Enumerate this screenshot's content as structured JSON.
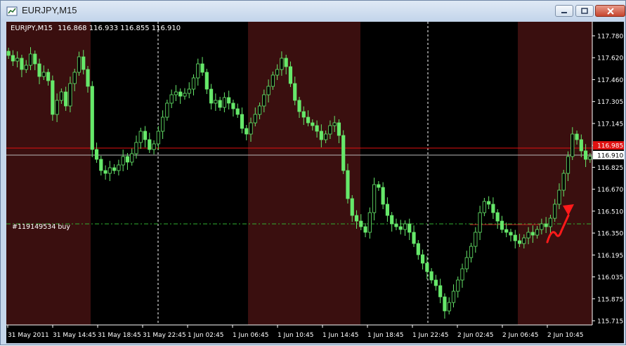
{
  "window": {
    "title": "EURJPY,M15",
    "minimize_label": "minimize",
    "maximize_label": "maximize",
    "close_label": "close"
  },
  "chart_data": {
    "type": "candlestick",
    "symbol_header": "EURJPY,M15",
    "ohlc_header": "116.868 116.933 116.855 116.910",
    "order_label": "#119149534 buy",
    "current_price_label": "116.910",
    "red_level_label": "116.985",
    "y_ticks": [
      "117.780",
      "117.620",
      "117.460",
      "117.305",
      "117.145",
      "116.985",
      "116.825",
      "116.670",
      "116.510",
      "116.350",
      "116.195",
      "116.035",
      "115.875",
      "115.715"
    ],
    "x_ticks": [
      "31 May 2011",
      "31 May 14:45",
      "31 May 18:45",
      "31 May 22:45",
      "1 Jun 02:45",
      "1 Jun 06:45",
      "1 Jun 10:45",
      "1 Jun 14:45",
      "1 Jun 18:45",
      "1 Jun 22:45",
      "2 Jun 02:45",
      "2 Jun 06:45",
      "2 Jun 10:45"
    ],
    "ylim": [
      115.7,
      117.86
    ],
    "close_series": [
      117.62,
      117.58,
      117.6,
      117.52,
      117.55,
      117.63,
      117.56,
      117.47,
      117.5,
      117.44,
      117.2,
      117.3,
      117.36,
      117.26,
      117.42,
      117.5,
      117.61,
      117.52,
      117.4,
      116.95,
      116.88,
      116.8,
      116.78,
      116.82,
      116.8,
      116.84,
      116.9,
      116.86,
      116.92,
      117.0,
      117.08,
      117.02,
      116.95,
      116.99,
      117.08,
      117.18,
      117.28,
      117.34,
      117.36,
      117.33,
      117.35,
      117.38,
      117.46,
      117.56,
      117.5,
      117.38,
      117.28,
      117.3,
      117.25,
      117.32,
      117.28,
      117.24,
      117.2,
      117.1,
      117.06,
      117.14,
      117.2,
      117.26,
      117.34,
      117.4,
      117.48,
      117.52,
      117.6,
      117.54,
      117.42,
      117.3,
      117.22,
      117.18,
      117.14,
      117.12,
      117.08,
      117.02,
      117.06,
      117.12,
      117.14,
      117.05,
      116.8,
      116.6,
      116.48,
      116.44,
      116.4,
      116.36,
      116.5,
      116.7,
      116.68,
      116.56,
      116.48,
      116.42,
      116.4,
      116.38,
      116.42,
      116.36,
      116.28,
      116.2,
      116.14,
      116.08,
      116.02,
      115.98,
      115.9,
      115.8,
      115.86,
      115.94,
      116.02,
      116.1,
      116.18,
      116.26,
      116.36,
      116.5,
      116.58,
      116.56,
      116.5,
      116.44,
      116.38,
      116.36,
      116.34,
      116.3,
      116.28,
      116.32,
      116.36,
      116.34,
      116.38,
      116.42,
      116.4,
      116.46,
      116.56,
      116.66,
      116.78,
      116.9,
      117.06,
      117.02,
      116.94,
      116.88,
      116.9
    ]
  }
}
